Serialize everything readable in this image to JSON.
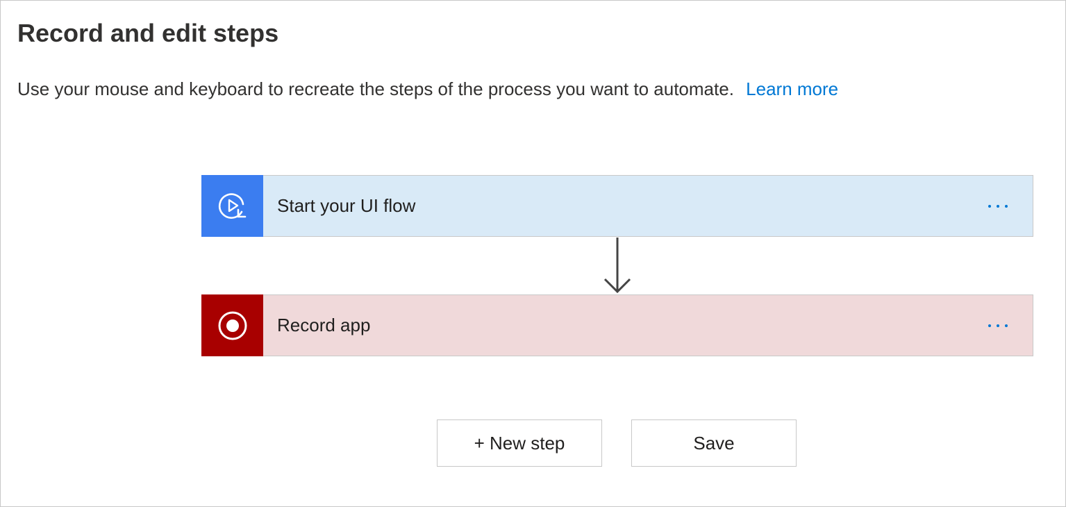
{
  "page": {
    "title": "Record and edit steps",
    "description": "Use your mouse and keyboard to recreate the steps of the process you want to automate.",
    "learn_more": "Learn more"
  },
  "steps": [
    {
      "label": "Start your UI flow",
      "icon": "play-replay-icon",
      "icon_bg": "#3b7df0",
      "card_bg": "#d9eaf7"
    },
    {
      "label": "Record app",
      "icon": "record-icon",
      "icon_bg": "#a80000",
      "card_bg": "#f0d9da"
    }
  ],
  "actions": {
    "new_step": "+ New step",
    "save": "Save"
  },
  "colors": {
    "link": "#0078d4",
    "menu_dots": "#0078d4",
    "border": "#c8c8c8"
  }
}
